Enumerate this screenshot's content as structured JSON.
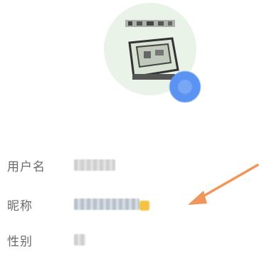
{
  "profile": {
    "avatar": {
      "icon": "avatar-image",
      "badge_icon": "camera-badge-icon",
      "badge_color": "#5b93f2"
    },
    "fields": [
      {
        "label": "用户名",
        "value": ""
      },
      {
        "label": "昵称",
        "value": ""
      },
      {
        "label": "性别",
        "value": ""
      }
    ]
  },
  "annotation": {
    "arrow_color": "#f0965a"
  }
}
